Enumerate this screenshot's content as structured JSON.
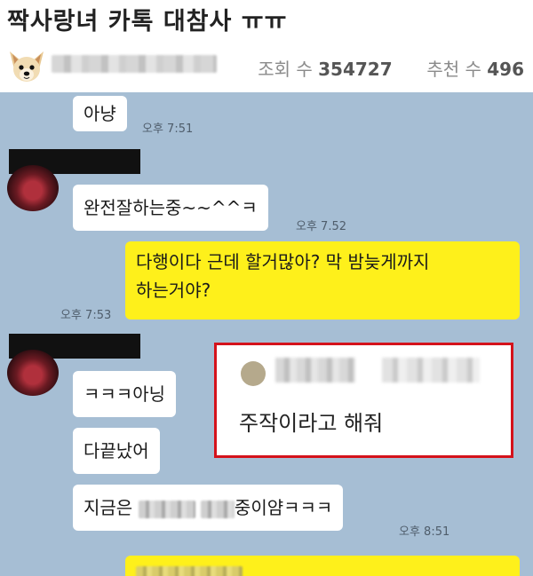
{
  "post": {
    "title": "짝사랑녀 카톡 대참사 ㅠㅠ",
    "views_label": "조회 수",
    "views": "354727",
    "recommend_label": "추천 수",
    "recommends": "496"
  },
  "chat": {
    "messages": [
      {
        "side": "received",
        "text": "아냥",
        "time": "오후 7:51"
      },
      {
        "side": "received",
        "text": "완전잘하는중~~^^ㅋ",
        "time": "오후 7.52"
      },
      {
        "side": "sent",
        "line1": "다행이다 근데 할거많아? 막 밤늦게까지",
        "line2": "하는거야?",
        "time": "오후 7:53"
      },
      {
        "side": "received",
        "text": "ㅋㅋㅋ아닝"
      },
      {
        "side": "received",
        "text": "다끝났어"
      },
      {
        "side": "received",
        "text_start": "지금은",
        "text_end": "중이얌ㅋㅋㅋ",
        "time": "오후 8:51"
      }
    ]
  },
  "comment": {
    "text": "주작이라고 해줘"
  },
  "colors": {
    "chat_background": "#a6bed4",
    "sent_bubble": "#fef01b",
    "received_bubble": "#ffffff",
    "highlight_border": "#d4121b"
  },
  "icons": [
    "dog-avatar-icon",
    "profile-photo-icon",
    "comment-avatar-icon"
  ]
}
